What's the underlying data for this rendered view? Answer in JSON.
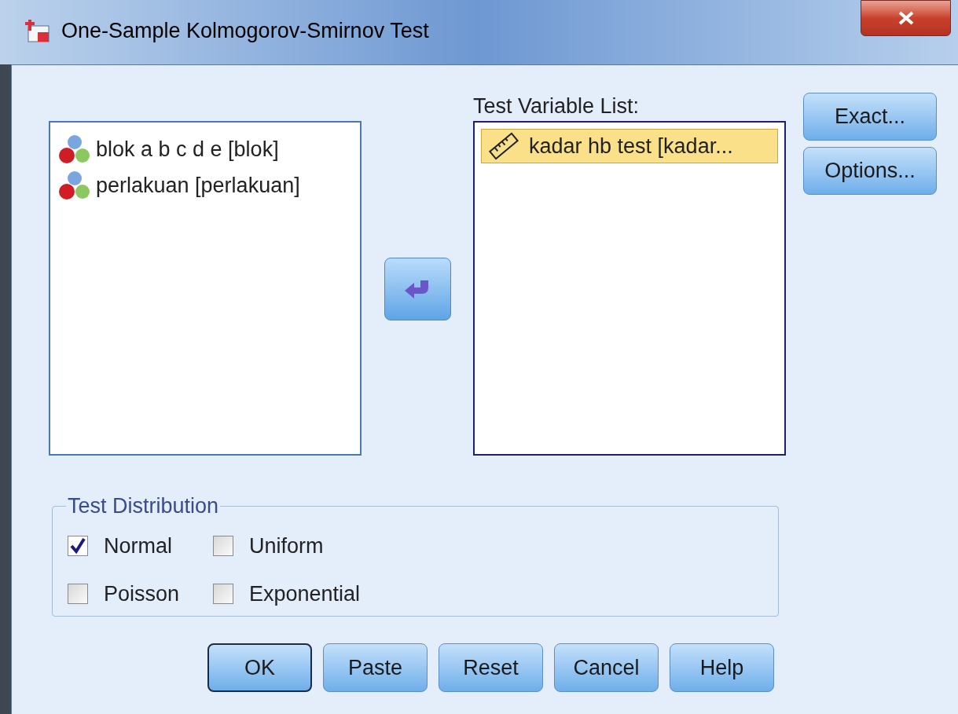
{
  "window": {
    "title": "One-Sample Kolmogorov-Smirnov Test"
  },
  "source_list": {
    "items": [
      {
        "label": "blok a b c d e [blok]",
        "kind": "nominal",
        "selected": false
      },
      {
        "label": "perlakuan [perlakuan]",
        "kind": "nominal",
        "selected": false
      }
    ]
  },
  "test_variable_list": {
    "label": "Test Variable List:",
    "items": [
      {
        "label": "kadar hb test [kadar...",
        "kind": "scale",
        "selected": true
      }
    ]
  },
  "side_buttons": [
    {
      "label": "Exact..."
    },
    {
      "label": "Options..."
    }
  ],
  "test_distribution": {
    "title": "Test Distribution",
    "options": [
      {
        "label": "Normal",
        "checked": true
      },
      {
        "label": "Uniform",
        "checked": false
      },
      {
        "label": "Poisson",
        "checked": false
      },
      {
        "label": "Exponential",
        "checked": false
      }
    ]
  },
  "buttons": [
    {
      "label": "OK",
      "default": true
    },
    {
      "label": "Paste",
      "default": false
    },
    {
      "label": "Reset",
      "default": false
    },
    {
      "label": "Cancel",
      "default": false
    },
    {
      "label": "Help",
      "default": false
    }
  ]
}
